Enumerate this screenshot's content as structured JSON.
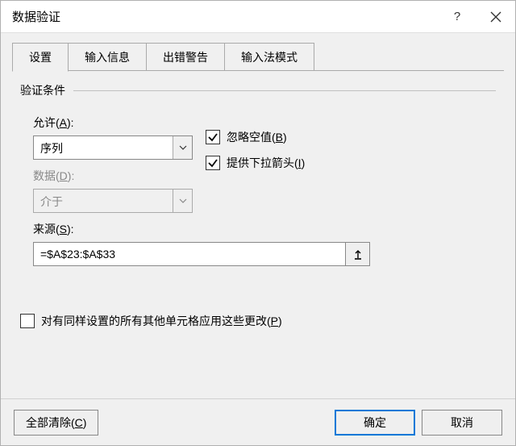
{
  "title": "数据验证",
  "tabs": {
    "settings": "设置",
    "input_msg": "输入信息",
    "error_alert": "出错警告",
    "ime_mode": "输入法模式"
  },
  "panel": {
    "group_label": "验证条件",
    "allow_label_prefix": "允许(",
    "allow_label_key": "A",
    "allow_label_suffix": "):",
    "allow_value": "序列",
    "data_label_prefix": "数据(",
    "data_label_key": "D",
    "data_label_suffix": "):",
    "data_value": "介于",
    "source_label_prefix": "来源(",
    "source_label_key": "S",
    "source_label_suffix": "):",
    "source_value": "=$A$23:$A$33",
    "ignore_blank_prefix": "忽略空值(",
    "ignore_blank_key": "B",
    "ignore_blank_suffix": ")",
    "dropdown_prefix": "提供下拉箭头(",
    "dropdown_key": "I",
    "dropdown_suffix": ")",
    "apply_prefix": "对有同样设置的所有其他单元格应用这些更改(",
    "apply_key": "P",
    "apply_suffix": ")"
  },
  "footer": {
    "clear_prefix": "全部清除(",
    "clear_key": "C",
    "clear_suffix": ")",
    "ok": "确定",
    "cancel": "取消"
  }
}
